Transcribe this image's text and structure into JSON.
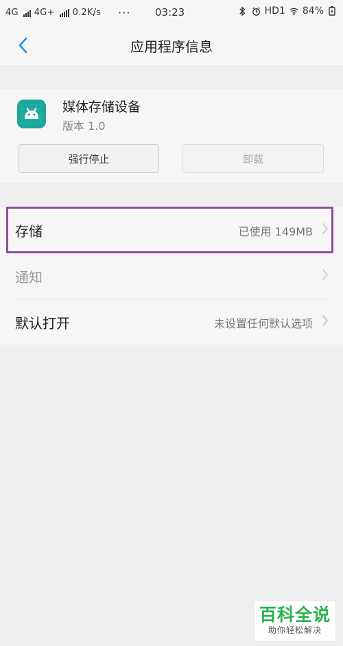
{
  "status_bar": {
    "network_1": "4G",
    "network_2": "4G+",
    "speed": "0.2K/s",
    "more": "···",
    "time": "03:23",
    "hd": "HD1",
    "battery": "84%"
  },
  "header": {
    "title": "应用程序信息"
  },
  "app": {
    "name": "媒体存储设备",
    "version": "版本 1.0",
    "icon_color": "#1aa79c"
  },
  "actions": {
    "force_stop": "强行停止",
    "uninstall": "卸载"
  },
  "settings": {
    "rows": [
      {
        "label": "存储",
        "value": "已使用 149MB"
      },
      {
        "label": "通知",
        "value": ""
      },
      {
        "label": "默认打开",
        "value": "未设置任何默认选项"
      }
    ]
  },
  "watermark": {
    "main": "百科全说",
    "sub": "助你轻松解决"
  },
  "colors": {
    "accent": "#2b8ee8",
    "highlight": "#8f4b9f",
    "watermark": "#27b44a"
  }
}
